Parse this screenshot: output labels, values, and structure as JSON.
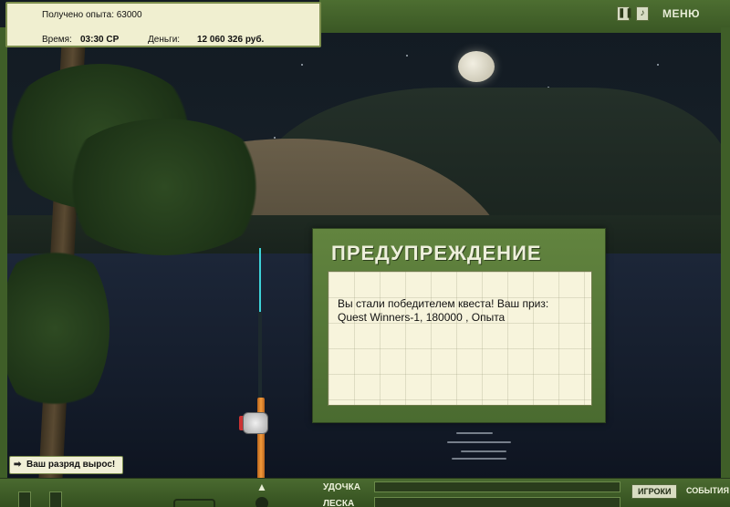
{
  "status": {
    "xp_text": "Получено опыта: 63000",
    "time_label": "Время:",
    "time_value": "03:30 СР",
    "money_label": "Деньги:",
    "money_value": "12 060 326 руб."
  },
  "top_controls": {
    "pause_icon": "pause-icon",
    "sound_icon": "sound-icon",
    "menu_label": "МЕНЮ"
  },
  "dialog": {
    "title": "ПРЕДУПРЕЖДЕНИЕ",
    "message_line1": "Вы стали победителем квеста! Ваш приз:",
    "message_line2": "Quest Winners-1, 180000 , Опыта"
  },
  "notification": {
    "text": "Ваш разряд вырос!"
  },
  "bottom_bar": {
    "rod_label": "УДОЧКА",
    "line_label": "ЛЕСКА",
    "players_button": "ИГРОКИ",
    "events_button": "СОБЫТИЯ"
  },
  "colors": {
    "frame_green": "#4a6b30",
    "panel_cream": "#f0efd0",
    "rod_handle_orange": "#f29a3a",
    "fishing_line_cyan": "#3ed2d8"
  }
}
